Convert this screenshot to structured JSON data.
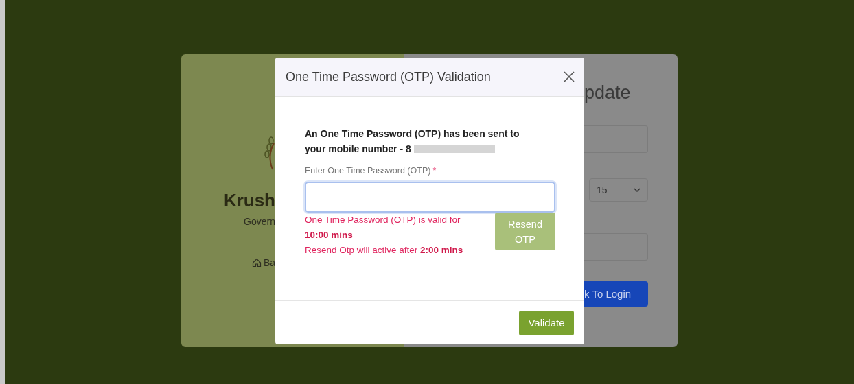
{
  "background": {
    "left_panel": {
      "brand": "Krush",
      "subtitle": "Govern",
      "home_link": "Ba"
    },
    "right_panel": {
      "heading": "pdate",
      "select_value": "15",
      "button": "k To Login"
    }
  },
  "modal": {
    "title": "One Time Password (OTP) Validation",
    "message_lines": [
      "An One Time Password (OTP) has been sent to",
      "your mobile number - 8"
    ],
    "field": {
      "label": "Enter One Time Password (OTP)",
      "required_mark": "*",
      "focused": true
    },
    "validity_note": "One Time Password (OTP) is valid for **10:00 mins**",
    "resend_note": "Resend Otp will active after **2:00 mins**",
    "resend_button": {
      "label": "Resend OTP",
      "disabled": true
    },
    "validate_button": "Validate"
  }
}
